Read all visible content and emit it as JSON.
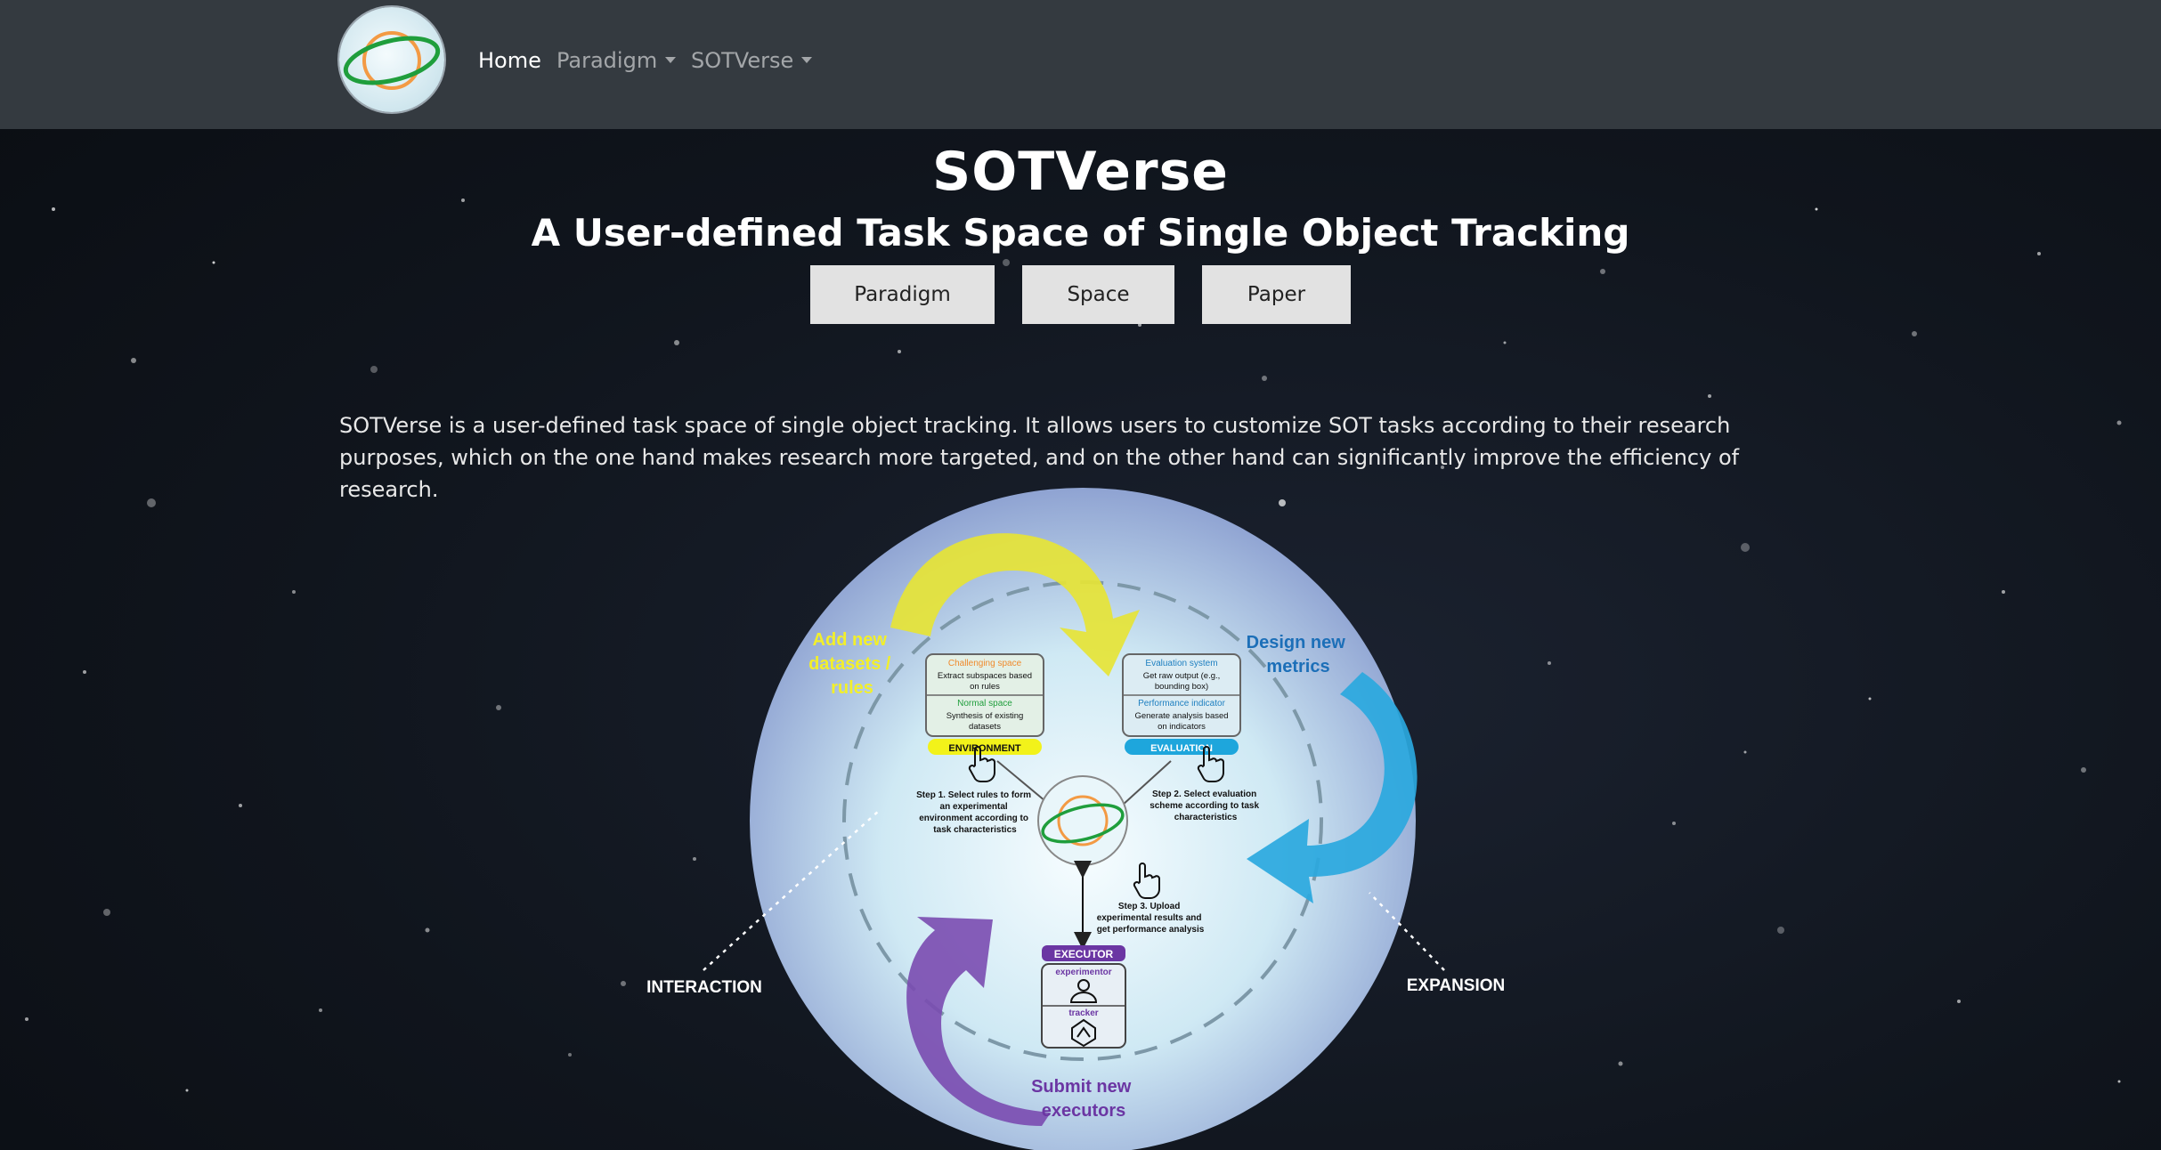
{
  "nav": {
    "home": "Home",
    "paradigm": "Paradigm",
    "sotverse": "SOTVerse"
  },
  "hero": {
    "title": "SOTVerse",
    "subtitle": "A User-defined Task Space of Single Object Tracking",
    "buttons": {
      "paradigm": "Paradigm",
      "space": "Space",
      "paper": "Paper"
    }
  },
  "description": "SOTVerse is a user-defined task space of single object tracking. It allows users to customize SOT tasks according to their research purposes, which on the one hand makes research more targeted, and on the other hand can significantly improve the efficiency of research.",
  "diagram": {
    "add_datasets": [
      "Add new",
      "datasets /",
      "rules"
    ],
    "design_metrics": [
      "Design new",
      "metrics"
    ],
    "submit_executors": [
      "Submit new",
      "executors"
    ],
    "interaction": "INTERACTION",
    "expansion": "EXPANSION",
    "environment": {
      "challenging_title": "Challenging space",
      "challenging_desc": [
        "Extract subspaces based",
        "on rules"
      ],
      "normal_title": "Normal space",
      "normal_desc": [
        "Synthesis of existing",
        "datasets"
      ],
      "label": "ENVIRONMENT"
    },
    "evaluation": {
      "system_title": "Evaluation system",
      "system_desc": [
        "Get raw output (e.g.,",
        "bounding box)"
      ],
      "indicator_title": "Performance indicator",
      "indicator_desc": [
        "Generate analysis based",
        "on indicators"
      ],
      "label": "EVALUATION"
    },
    "executor": {
      "label": "EXECUTOR",
      "experimentor": "experimentor",
      "tracker": "tracker"
    },
    "step1": [
      "Step 1. Select rules to form",
      "an experimental",
      "environment according to",
      "task characteristics"
    ],
    "step2": [
      "Step 2. Select evaluation",
      "scheme according to task",
      "characteristics"
    ],
    "step3": [
      "Step 3. Upload",
      "experimental results and",
      "get performance analysis"
    ]
  },
  "colors": {
    "navbar": "#343a40",
    "button_bg": "#e2e2e2",
    "yellow": "#e6e436",
    "blue": "#2aa8de",
    "purple": "#7a4bb0",
    "environment_bar": "#f2f21a",
    "evaluation_bar": "#1ea6dc",
    "executor_bar": "#6b36a3",
    "orbit_orange": "#f39a44",
    "orbit_green": "#1f9e3c"
  },
  "icons": [
    "planet-logo-icon",
    "caret-down-icon",
    "pointer-hand-icon",
    "person-icon",
    "tracker-icon"
  ]
}
